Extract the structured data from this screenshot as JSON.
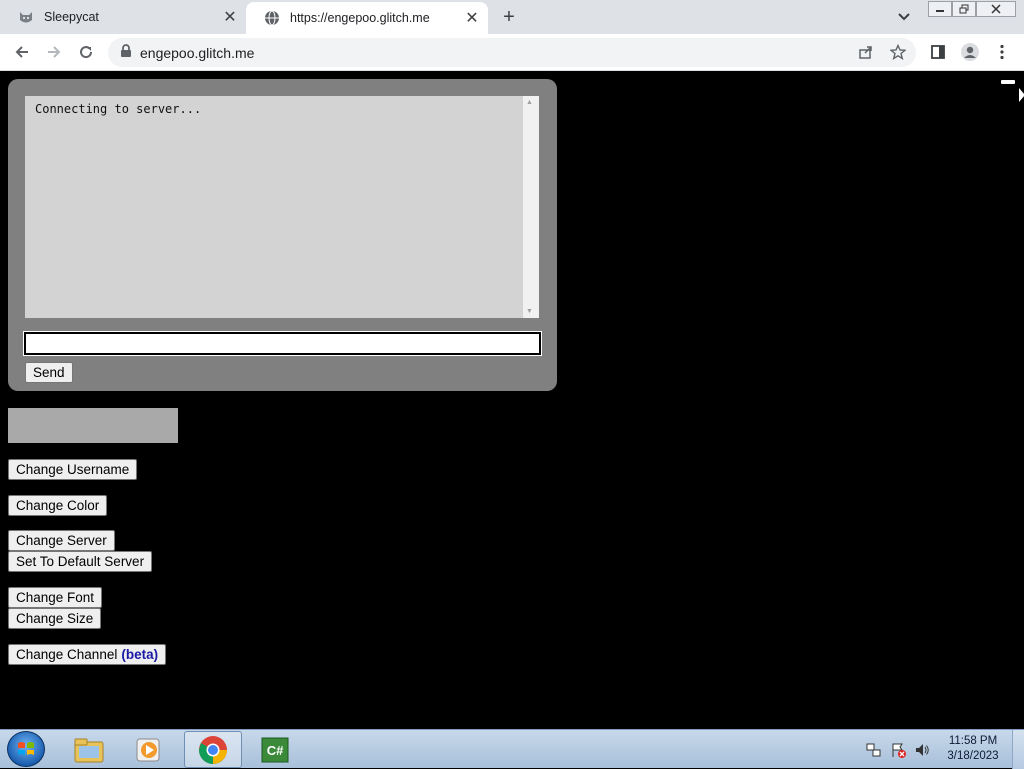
{
  "browser": {
    "tabs": [
      {
        "title": "Sleepycat",
        "icon": "cat-icon",
        "active": false
      },
      {
        "title": "https://engepoo.glitch.me",
        "icon": "globe-icon",
        "active": true
      }
    ],
    "url": "engepoo.glitch.me"
  },
  "chat": {
    "log_text": "Connecting to server...",
    "input_value": "",
    "send_label": "Send"
  },
  "controls": {
    "change_username": "Change Username",
    "change_color": "Change Color",
    "change_server": "Change Server",
    "set_default_server": "Set To Default Server",
    "change_font": "Change Font",
    "change_size": "Change Size",
    "change_channel": "Change Channel",
    "beta_label": "(beta)"
  },
  "taskbar": {
    "apps": [
      "start-menu",
      "file-explorer-icon",
      "media-player-icon",
      "chrome-icon",
      "csharp-icon"
    ],
    "clock_time": "11:58 PM",
    "clock_date": "3/18/2023"
  },
  "colors": {
    "page_bg": "#000000",
    "panel_bg": "#808080",
    "log_bg": "#d3d3d3",
    "beta_text": "#1a1aa6"
  }
}
